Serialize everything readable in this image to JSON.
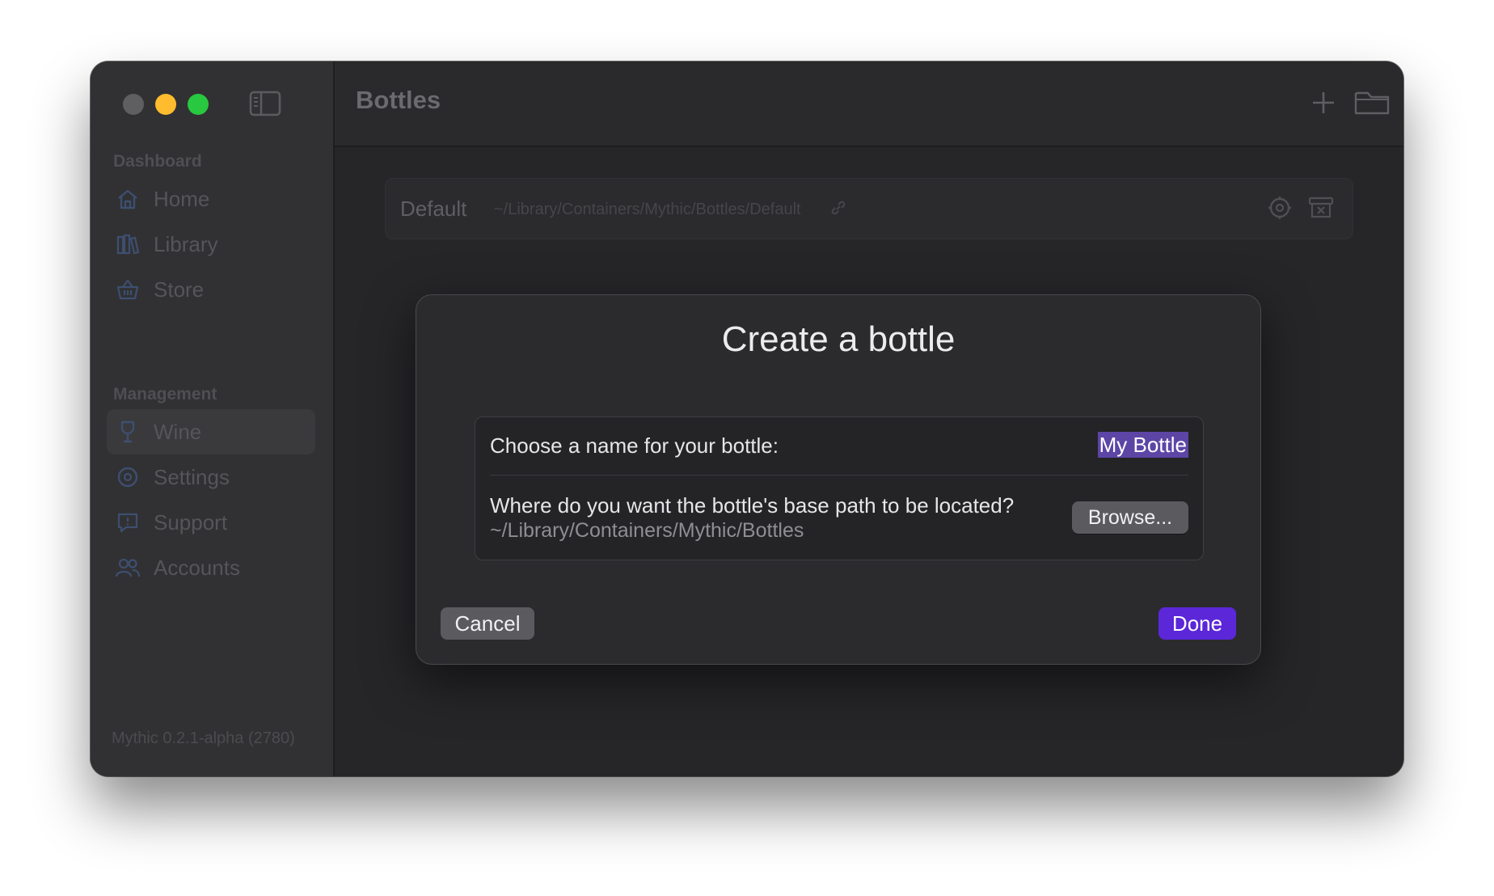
{
  "app": {
    "version": "Mythic 0.2.1-alpha (2780)"
  },
  "sidebar": {
    "sections": [
      {
        "label": "Dashboard",
        "items": [
          {
            "label": "Home",
            "icon": "home-icon"
          },
          {
            "label": "Library",
            "icon": "books-icon"
          },
          {
            "label": "Store",
            "icon": "basket-icon"
          }
        ]
      },
      {
        "label": "Management",
        "items": [
          {
            "label": "Wine",
            "icon": "wine-glass-icon",
            "active": true
          },
          {
            "label": "Settings",
            "icon": "gear-icon"
          },
          {
            "label": "Support",
            "icon": "support-bubble-icon"
          },
          {
            "label": "Accounts",
            "icon": "people-icon"
          }
        ]
      }
    ]
  },
  "header": {
    "title": "Bottles",
    "actions": [
      "plus-icon",
      "folder-icon"
    ]
  },
  "bottles": [
    {
      "name": "Default",
      "path": "~/Library/Containers/Mythic/Bottles/Default"
    }
  ],
  "dialog": {
    "title": "Create a bottle",
    "name_label": "Choose a name for your bottle:",
    "name_value": "My Bottle",
    "path_question": "Where do you want the bottle's base path to be located?",
    "path_value": "~/Library/Containers/Mythic/Bottles",
    "browse_label": "Browse...",
    "cancel_label": "Cancel",
    "done_label": "Done"
  },
  "colors": {
    "accent": "#5b27d8",
    "selection": "#5d45a6",
    "traffic_close": "#5f5f61",
    "traffic_minimize": "#febc2e",
    "traffic_maximize": "#28c840"
  }
}
